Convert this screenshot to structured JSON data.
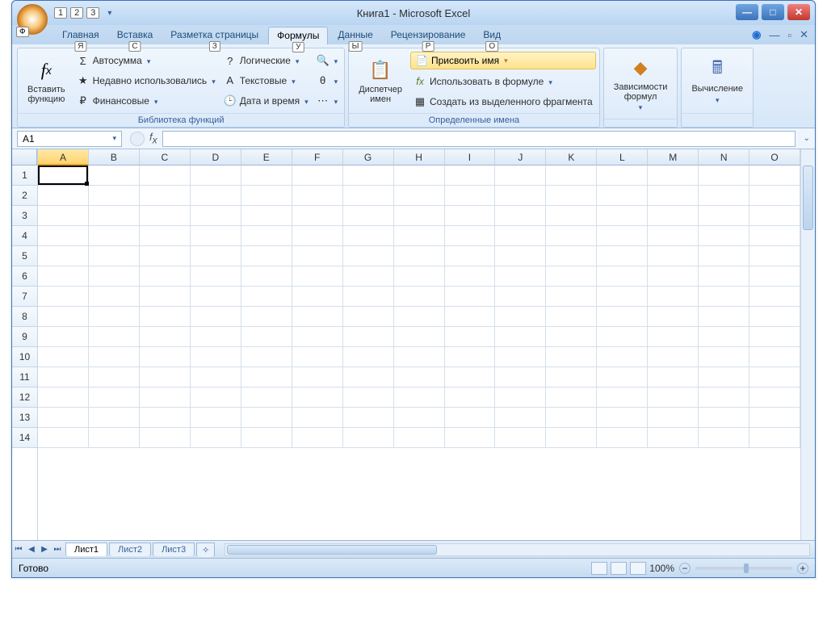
{
  "title": "Книга1 - Microsoft Excel",
  "qat_keys": [
    "1",
    "2",
    "3"
  ],
  "office_key": "Ф",
  "tabs": {
    "items": [
      {
        "label": "Главная",
        "key": "Я",
        "active": false
      },
      {
        "label": "Вставка",
        "key": "С",
        "active": false
      },
      {
        "label": "Разметка страницы",
        "key": "З",
        "active": false
      },
      {
        "label": "Формулы",
        "key": "У",
        "active": true
      },
      {
        "label": "Данные",
        "key": "Ы",
        "active": false
      },
      {
        "label": "Рецензирование",
        "key": "Р",
        "active": false
      },
      {
        "label": "Вид",
        "key": "О",
        "active": false
      }
    ]
  },
  "ribbon": {
    "insert_fn": {
      "label": "Вставить\nфункцию"
    },
    "lib_group_title": "Библиотека функций",
    "lib_col1": [
      {
        "label": "Автосумма",
        "icon": "Σ"
      },
      {
        "label": "Недавно использовались",
        "icon": "★"
      },
      {
        "label": "Финансовые",
        "icon": "₽"
      }
    ],
    "lib_col2": [
      {
        "label": "Логические",
        "icon": "?"
      },
      {
        "label": "Текстовые",
        "icon": "A"
      },
      {
        "label": "Дата и время",
        "icon": "🕒"
      }
    ],
    "lib_col3_icons": [
      "🔍",
      "θ",
      "⋯"
    ],
    "name_mgr": {
      "label": "Диспетчер\nимен"
    },
    "defnames_title": "Определенные имена",
    "assign_name": "Присвоить имя",
    "use_in_formula": "Использовать в формуле",
    "create_from_sel": "Создать из выделенного фрагмента",
    "audit_label": "Зависимости\nформул",
    "calc_label": "Вычисление"
  },
  "namebox": "A1",
  "columns": [
    "A",
    "B",
    "C",
    "D",
    "E",
    "F",
    "G",
    "H",
    "I",
    "J",
    "K",
    "L",
    "M",
    "N",
    "O"
  ],
  "selected_col": "A",
  "rows": [
    1,
    2,
    3,
    4,
    5,
    6,
    7,
    8,
    9,
    10,
    11,
    12,
    13,
    14
  ],
  "sheets": [
    "Лист1",
    "Лист2",
    "Лист3"
  ],
  "active_sheet": "Лист1",
  "status": "Готово",
  "zoom": "100%"
}
